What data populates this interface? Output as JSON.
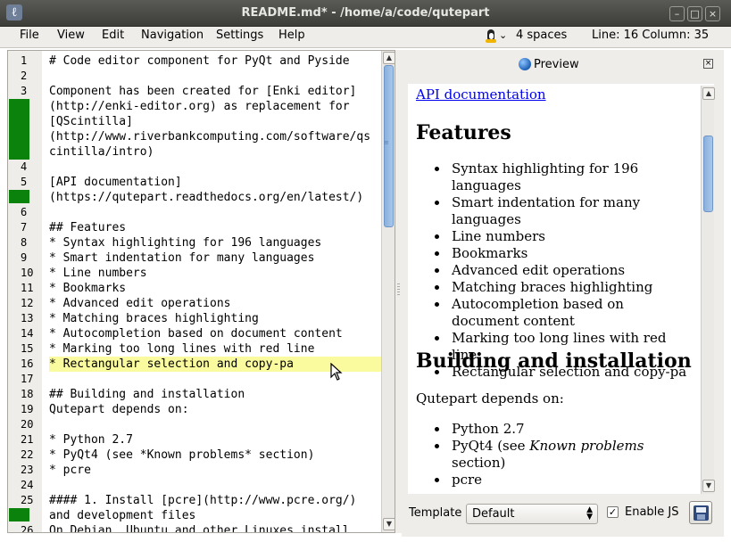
{
  "window": {
    "title": "README.md* - /home/a/code/qutepart",
    "buttons": [
      "minimize",
      "maximize",
      "close"
    ]
  },
  "menubar": {
    "items": [
      "File",
      "View",
      "Edit",
      "Navigation",
      "Settings",
      "Help"
    ],
    "indent_status": "4 spaces",
    "position_status": "Line: 16 Column: 35",
    "indent_icon": "tux-icon"
  },
  "editor": {
    "current_line": 16,
    "rows": [
      {
        "num": "1",
        "text": "# Code editor component for PyQt and Pyside"
      },
      {
        "num": "2",
        "text": ""
      },
      {
        "num": "3",
        "text": "Component has been created for [Enki editor]"
      },
      {
        "num": "",
        "text": "(http://enki-editor.org) as replacement for"
      },
      {
        "num": "",
        "text": "[QScintilla]"
      },
      {
        "num": "",
        "text": "(http://www.riverbankcomputing.com/software/qs"
      },
      {
        "num": "",
        "text": "cintilla/intro)"
      },
      {
        "num": "4",
        "text": ""
      },
      {
        "num": "5",
        "text": "[API documentation]"
      },
      {
        "num": "",
        "text": "(https://qutepart.readthedocs.org/en/latest/)"
      },
      {
        "num": "6",
        "text": ""
      },
      {
        "num": "7",
        "text": "## Features"
      },
      {
        "num": "8",
        "text": "* Syntax highlighting for 196 languages"
      },
      {
        "num": "9",
        "text": "* Smart indentation for many languages"
      },
      {
        "num": "10",
        "text": "* Line numbers"
      },
      {
        "num": "11",
        "text": "* Bookmarks"
      },
      {
        "num": "12",
        "text": "* Advanced edit operations"
      },
      {
        "num": "13",
        "text": "* Matching braces highlighting"
      },
      {
        "num": "14",
        "text": "* Autocompletion based on document content"
      },
      {
        "num": "15",
        "text": "* Marking too long lines with red line"
      },
      {
        "num": "16",
        "text": "* Rectangular selection and copy-pa"
      },
      {
        "num": "17",
        "text": ""
      },
      {
        "num": "18",
        "text": "## Building and installation"
      },
      {
        "num": "19",
        "text": "Qutepart depends on:"
      },
      {
        "num": "20",
        "text": ""
      },
      {
        "num": "21",
        "text": "* Python 2.7"
      },
      {
        "num": "22",
        "text": "* PyQt4 (see *Known problems* section)"
      },
      {
        "num": "23",
        "text": "* pcre"
      },
      {
        "num": "24",
        "text": ""
      },
      {
        "num": "25",
        "text": "#### 1. Install [pcre](http://www.pcre.org/)"
      },
      {
        "num": "",
        "text": "and development files"
      },
      {
        "num": "26",
        "text": "On Debian, Ubuntu and other Linuxes install"
      }
    ]
  },
  "preview": {
    "title": "Preview",
    "link": "API documentation",
    "features_heading": "Features",
    "features": [
      "Syntax highlighting for 196 languages",
      "Smart indentation for many languages",
      "Line numbers",
      "Bookmarks",
      "Advanced edit operations",
      "Matching braces highlighting",
      "Autocompletion based on document content",
      "Marking too long lines with red line",
      "Rectangular selection and copy-pa"
    ],
    "building_heading": "Building and installation",
    "depends_text": "Qutepart depends on:",
    "deps": [
      {
        "main": "Python 2.7",
        "em": "",
        "tail": ""
      },
      {
        "main": "PyQt4 (see ",
        "em": "Known problems",
        "tail": " section)"
      },
      {
        "main": "pcre",
        "em": "",
        "tail": ""
      }
    ]
  },
  "bottombar": {
    "template_label": "Template",
    "template_value": "Default",
    "enable_js_label": "Enable JS",
    "enable_js_checked": true
  },
  "colors": {
    "marker": "#0b820b",
    "current_line": "#fafa9e",
    "link": "#0000ee"
  }
}
